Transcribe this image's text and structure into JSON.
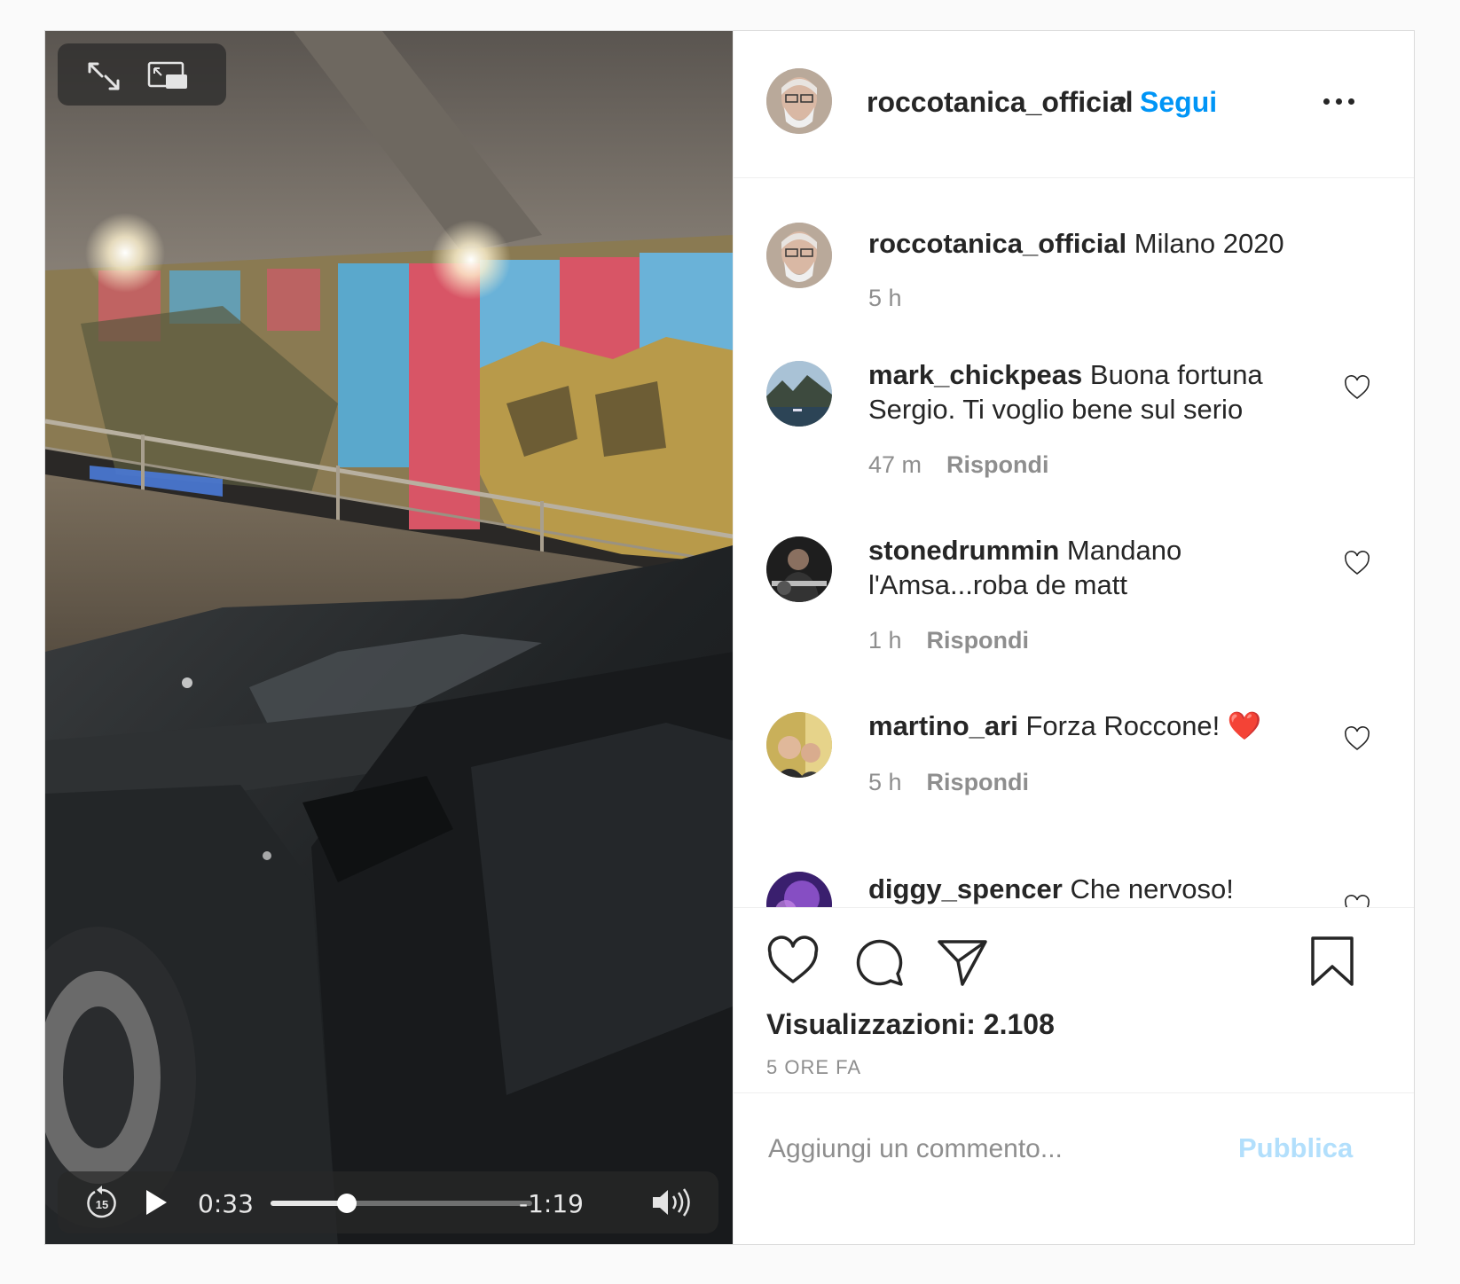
{
  "video": {
    "current_time": "0:33",
    "remaining_time": "-1:19",
    "progress": 0.29,
    "skip_back_label": "15"
  },
  "header": {
    "username": "roccotanica_official",
    "separator": "•",
    "follow_label": "Segui"
  },
  "caption": {
    "username": "roccotanica_official",
    "text": "Milano 2020",
    "time": "5 h"
  },
  "comments": [
    {
      "username": "mark_chickpeas",
      "text": "Buona fortuna Sergio. Ti voglio bene sul serio",
      "time": "47 m",
      "reply_label": "Rispondi"
    },
    {
      "username": "stonedrummin",
      "text": "Mandano l'Amsa...roba de matt",
      "time": "1 h",
      "reply_label": "Rispondi"
    },
    {
      "username": "martino_ari",
      "text": "Forza Roccone! ❤️",
      "time": "5 h",
      "reply_label": "Rispondi"
    },
    {
      "username": "diggy_spencer",
      "text": "Che nervoso!",
      "time": "",
      "reply_label": ""
    }
  ],
  "stats": {
    "views": "Visualizzazioni: 2.108",
    "time_ago": "5 ORE FA"
  },
  "add_comment": {
    "placeholder": "Aggiungi un commento...",
    "publish_label": "Pubblica"
  },
  "colors": {
    "link_blue": "#0095f6",
    "publish_disabled": "#b2dffc",
    "muted_text": "#8e8e8e",
    "heart_red": "#ed1c24"
  },
  "icons": {
    "top_controls": [
      "expand-icon",
      "picture-in-picture-icon"
    ],
    "bottom_controls": [
      "skip-back-15-icon",
      "play-icon",
      "volume-icon"
    ],
    "actions": [
      "heart-icon",
      "comment-icon",
      "share-icon",
      "bookmark-icon"
    ]
  }
}
